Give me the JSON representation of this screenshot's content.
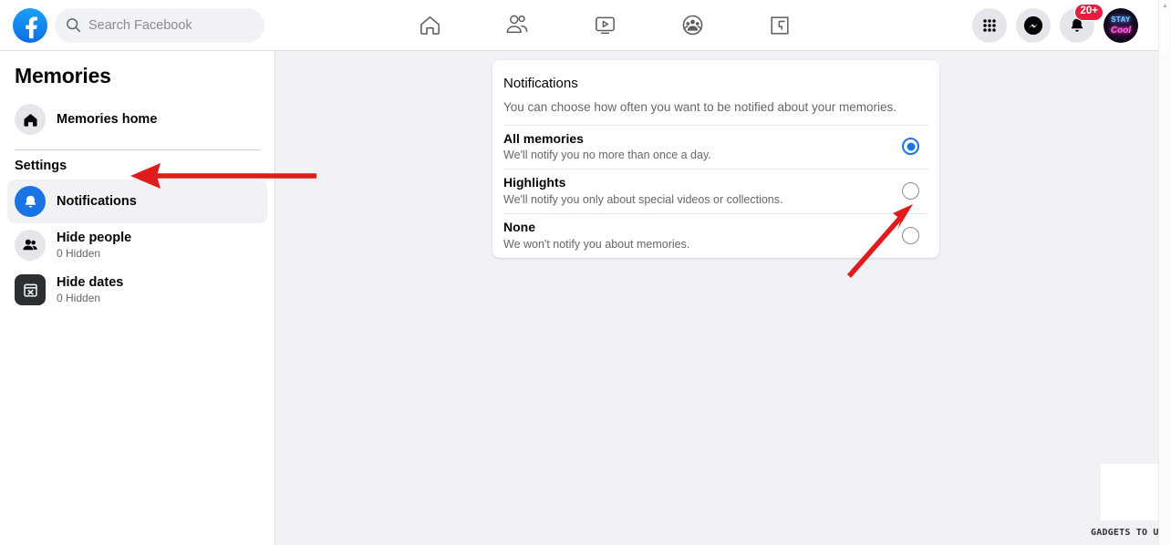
{
  "header": {
    "logo_icon": "facebook-logo-icon",
    "search": {
      "icon": "search-icon",
      "placeholder": "Search Facebook",
      "value": ""
    },
    "nav": [
      {
        "name": "home",
        "icon": "home-icon",
        "label": "Home"
      },
      {
        "name": "friends",
        "icon": "friends-icon",
        "label": "Friends"
      },
      {
        "name": "watch",
        "icon": "video-play-icon",
        "label": "Watch"
      },
      {
        "name": "groups",
        "icon": "groups-icon",
        "label": "Groups"
      },
      {
        "name": "gaming",
        "icon": "gaming-icon",
        "label": "Gaming"
      }
    ],
    "actions": [
      {
        "name": "menu-grid",
        "icon": "grid-menu-icon",
        "label": "Menu"
      },
      {
        "name": "messenger",
        "icon": "messenger-icon",
        "label": "Messenger"
      },
      {
        "name": "notifications",
        "icon": "bell-icon",
        "label": "Notifications",
        "badge": "20+"
      }
    ],
    "avatar": {
      "icon": "avatar",
      "text_top": "STAY",
      "text_bottom": "Cool"
    }
  },
  "sidebar": {
    "title": "Memories",
    "home": {
      "icon": "house-icon",
      "label": "Memories home"
    },
    "section_label": "Settings",
    "items": [
      {
        "icon": "bell-icon",
        "label": "Notifications",
        "sub": "",
        "active": true
      },
      {
        "icon": "people-icon",
        "label": "Hide people",
        "sub": "0 Hidden",
        "active": false
      },
      {
        "icon": "calendar-x-icon",
        "label": "Hide dates",
        "sub": "0 Hidden",
        "active": false
      }
    ]
  },
  "card": {
    "title": "Notifications",
    "description": "You can choose how often you want to be notified about your memories.",
    "options": [
      {
        "label": "All memories",
        "sub": "We'll notify you no more than once a day.",
        "selected": true
      },
      {
        "label": "Highlights",
        "sub": "We'll notify you only about special videos or collections.",
        "selected": false
      },
      {
        "label": "None",
        "sub": "We won't notify you about memories.",
        "selected": false
      }
    ]
  },
  "annotations": {
    "color": "#e01b1b",
    "arrow_left": {
      "name": "arrow-pointing-to-notifications-sidebar"
    },
    "arrow_upright": {
      "name": "arrow-pointing-to-none-radio"
    }
  },
  "watermark": {
    "text": "GADGETS TO USE"
  },
  "scrollbar": {
    "up_arrow_icon": "chevron-up-icon"
  },
  "colors": {
    "accent": "#1b74e4",
    "badge": "#e41e3f",
    "annotation": "#e01b1b",
    "page_bg": "#f0f2f5",
    "surface": "#ffffff",
    "text_primary": "#050505",
    "text_secondary": "#65676b"
  }
}
